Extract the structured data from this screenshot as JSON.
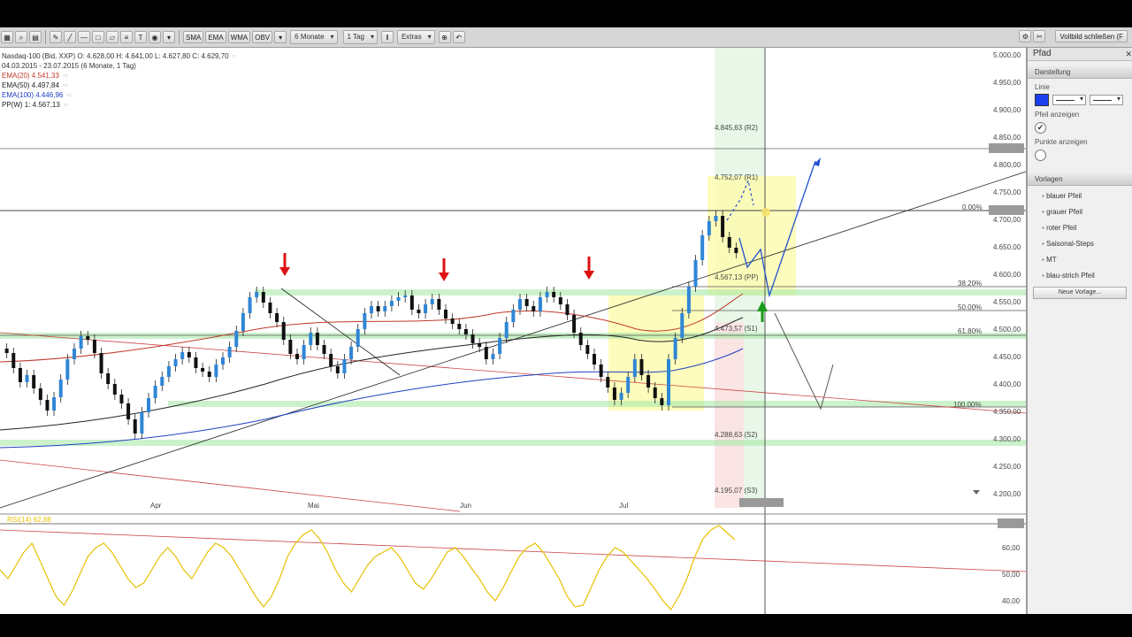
{
  "toolbar": {
    "left_icons": [
      "grid-icon",
      "magnifier-icon",
      "table-icon"
    ],
    "indicators": [
      "SMA",
      "EMA",
      "WMA",
      "OBV"
    ],
    "range": "6 Monate",
    "interval": "1 Tag",
    "extras": "Extras",
    "right_button": "Vollbild schließen (F"
  },
  "info": {
    "title": "Nasdaq-100 (Bid, XXP)  O: 4.628,00  H: 4.641,00  L: 4.627,80  C: 4.629,70",
    "range": "04.03.2015 - 23.07.2015 (6 Monate, 1 Tag)",
    "ema20": "EMA(20)  4.541,33",
    "ema50": "EMA(50)  4.497,84",
    "ema100": "EMA(100)  4.446,96",
    "pp": "PP(W)  1: 4.567,13",
    "colors": {
      "ema20": "#c0392b",
      "ema50": "#222222",
      "ema100": "#2040c0",
      "pp": "#222222"
    }
  },
  "price_axis": {
    "labels": [
      "5.000,00",
      "4.950,00",
      "4.900,00",
      "4.850,00",
      "4.800,00",
      "4.750,00",
      "4.700,00",
      "4.650,00",
      "4.600,00",
      "4.550,00",
      "4.500,00",
      "4.450,00",
      "4.400,00",
      "4.350,00",
      "4.300,00",
      "4.250,00",
      "4.200,00"
    ]
  },
  "time_axis": {
    "labels": [
      "Apr",
      "Mai",
      "Jun",
      "Jul"
    ]
  },
  "pivots": {
    "r2": "4.845,63 (R2)",
    "r1": "4.752,07 (R1)",
    "pp": "4.567,13 (PP)",
    "s1": "4.473,57 (S1)",
    "s2": "4.288,63 (S2)",
    "s3": "4.195,07 (S3)"
  },
  "fib": {
    "f0": "0.00%",
    "f38": "38.20%",
    "f50": "50.00%",
    "f61": "61.80%",
    "f100": "100.00%"
  },
  "rsi": {
    "label": "RSI(14)  62,88",
    "axis": [
      "60,00",
      "50,00",
      "40,00"
    ],
    "color": "#e8c000"
  },
  "panel": {
    "title": "Pfad",
    "sections": {
      "display": "Darstellung",
      "templates": "Vorlagen"
    },
    "line_label": "Linie",
    "show_arrow": "Pfeil anzeigen",
    "show_points": "Punkte anzeigen",
    "color": "#1b3ff0",
    "templates": [
      "blauer Pfeil",
      "grauer Pfeil",
      "roter Pfeil",
      "Saisonal-Steps",
      "MT",
      "blau-strich Pfeil"
    ],
    "new_template": "Neue Vorlage..."
  }
}
